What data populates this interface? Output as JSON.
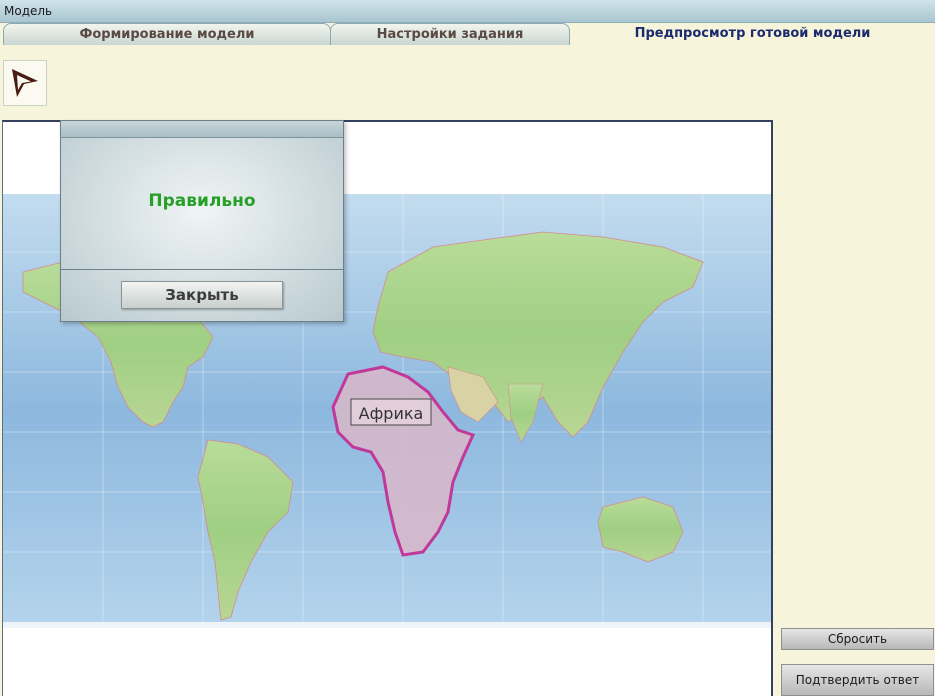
{
  "window": {
    "title": "Модель"
  },
  "tabs": [
    {
      "label": "Формирование модели"
    },
    {
      "label": "Настройки задания"
    },
    {
      "label": "Предпросмотр готовой модели",
      "active": true
    }
  ],
  "tools": {
    "pointer_icon": "arrow-pointer-icon"
  },
  "map": {
    "selected_region_label": "Африка",
    "highlight_color": "#c0399a"
  },
  "popup": {
    "message": "Правильно",
    "close_label": "Закрыть"
  },
  "actions": {
    "reset_label": "Сбросить",
    "submit_label": "Подтвердить ответ"
  },
  "colors": {
    "success": "#28a028",
    "active_tab_text": "#1c2a6e"
  }
}
